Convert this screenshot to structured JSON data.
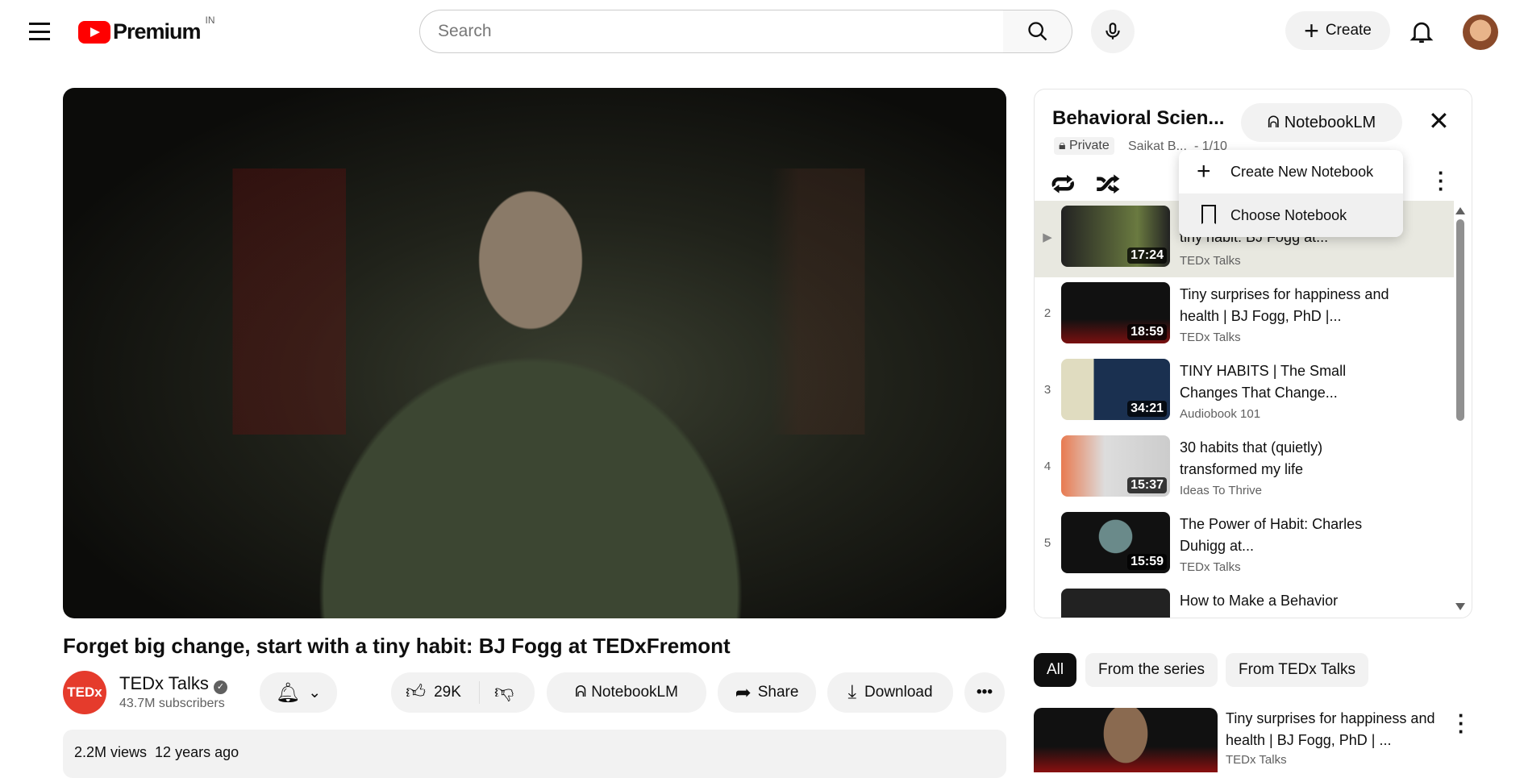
{
  "header": {
    "logo_text": "Premium",
    "region": "IN",
    "search_placeholder": "Search",
    "create_label": "Create"
  },
  "video": {
    "title": "Forget big change, start with a tiny habit: BJ Fogg at TEDxFremont",
    "channel": "TEDx Talks",
    "channel_logo": "TEDx",
    "subscribers": "43.7M subscribers",
    "likes": "29K",
    "notebook_label": "NotebookLM",
    "share_label": "Share",
    "download_label": "Download",
    "views": "2.2M views",
    "age": "12 years ago"
  },
  "playlist": {
    "title": "Behavioral Scien...",
    "notebook_label": "NotebookLM",
    "privacy": "Private",
    "owner": "Saikat B...",
    "position": "- 1/10",
    "menu": [
      "Create New Notebook",
      "Choose Notebook"
    ],
    "items": [
      {
        "num": "▶",
        "title": "tiny habit: BJ Fogg at...",
        "channel": "TEDx Talks",
        "duration": "17:24"
      },
      {
        "num": "2",
        "title": "Tiny surprises for happiness and health | BJ Fogg, PhD |...",
        "channel": "TEDx Talks",
        "duration": "18:59"
      },
      {
        "num": "3",
        "title": "TINY HABITS | The Small Changes That Change...",
        "channel": "Audiobook 101",
        "duration": "34:21"
      },
      {
        "num": "4",
        "title": "30 habits that (quietly) transformed my life",
        "channel": "Ideas To Thrive",
        "duration": "15:37"
      },
      {
        "num": "5",
        "title": "The Power of Habit: Charles Duhigg at...",
        "channel": "TEDx Talks",
        "duration": "15:59"
      },
      {
        "num": "",
        "title": "How to Make a Behavior",
        "channel": "",
        "duration": ""
      }
    ]
  },
  "chips": [
    "All",
    "From the series",
    "From TEDx Talks"
  ],
  "recommended": {
    "title": "Tiny surprises for happiness and health | BJ Fogg, PhD | ...",
    "channel": "TEDx Talks"
  },
  "colors": {
    "brand": "#ff0000",
    "active_row": "#e8e8e0"
  }
}
